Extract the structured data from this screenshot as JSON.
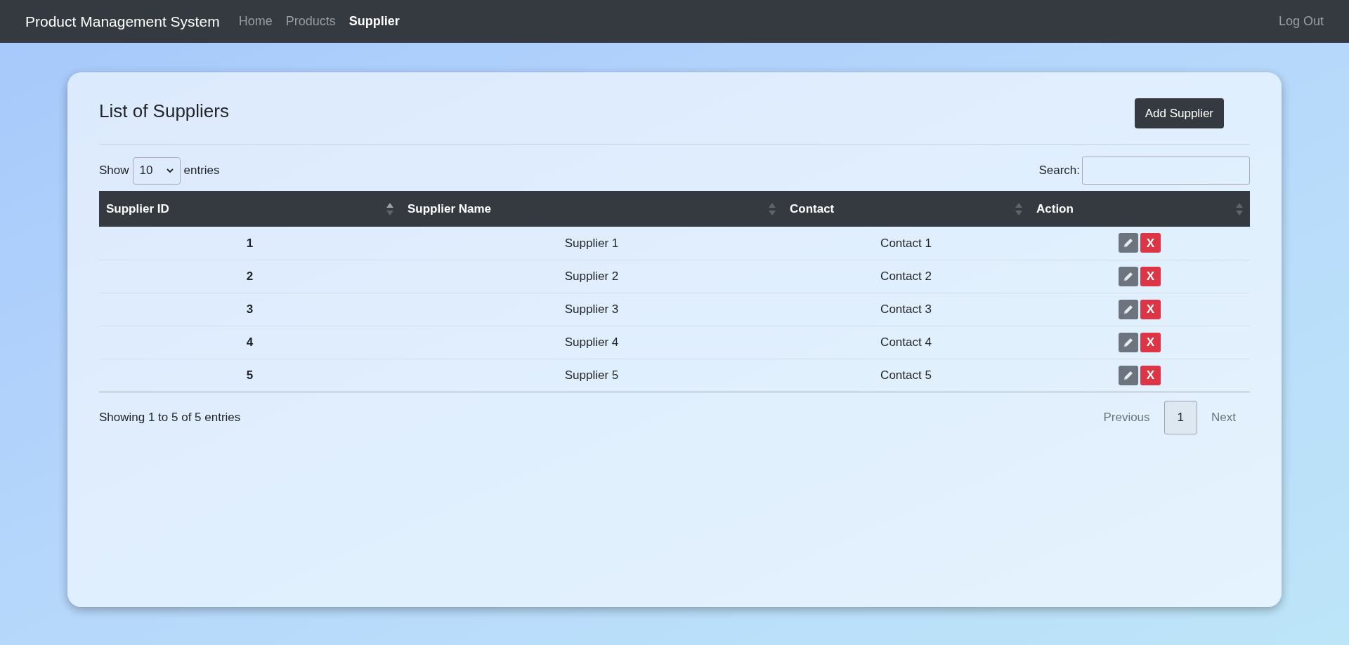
{
  "navbar": {
    "brand": "Product Management System",
    "links": [
      {
        "label": "Home",
        "selected": false
      },
      {
        "label": "Products",
        "selected": false
      },
      {
        "label": "Supplier",
        "selected": true
      }
    ],
    "logout": "Log Out"
  },
  "card": {
    "title": "List of Suppliers",
    "add_button": "Add Supplier",
    "length_control": {
      "before": "Show",
      "value": "10",
      "after": "entries"
    },
    "search": {
      "label": "Search:"
    },
    "table": {
      "columns": [
        {
          "label": "Supplier ID",
          "sorted": true
        },
        {
          "label": "Supplier Name",
          "sorted": false
        },
        {
          "label": "Contact",
          "sorted": false
        },
        {
          "label": "Action",
          "sorted": false
        }
      ],
      "rows": [
        {
          "id": "1",
          "name": "Supplier 1",
          "contact": "Contact 1",
          "delete": "X"
        },
        {
          "id": "2",
          "name": "Supplier 2",
          "contact": "Contact 2",
          "delete": "X"
        },
        {
          "id": "3",
          "name": "Supplier 3",
          "contact": "Contact 3",
          "delete": "X"
        },
        {
          "id": "4",
          "name": "Supplier 4",
          "contact": "Contact 4",
          "delete": "X"
        },
        {
          "id": "5",
          "name": "Supplier 5",
          "contact": "Contact 5",
          "delete": "X"
        }
      ]
    },
    "info": "Showing 1 to 5 of 5 entries",
    "pagination": [
      {
        "label": "Previous",
        "selected": false
      },
      {
        "label": "1",
        "selected": true
      },
      {
        "label": "Next",
        "selected": false
      }
    ]
  }
}
